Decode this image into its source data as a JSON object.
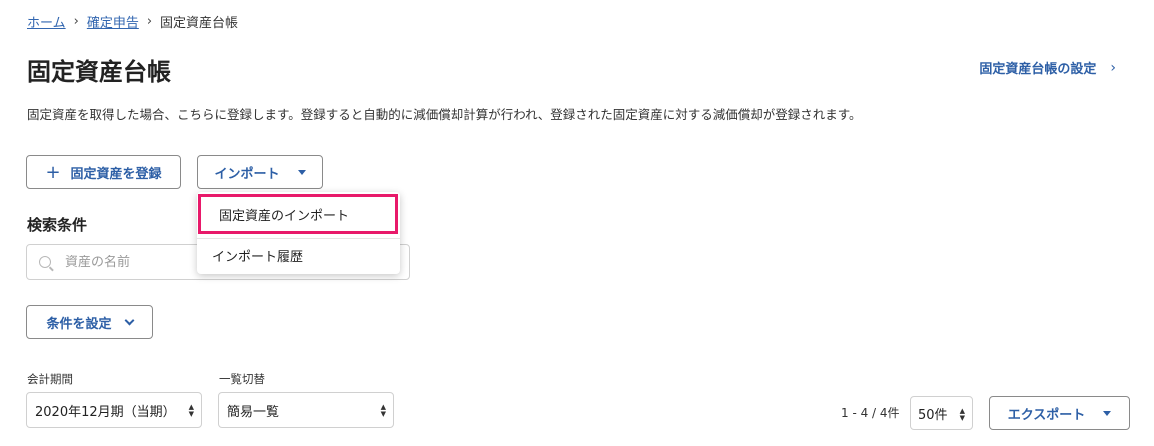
{
  "breadcrumb": {
    "home": "ホーム",
    "tax_return": "確定申告",
    "current": "固定資産台帳",
    "separator": "›"
  },
  "page": {
    "title": "固定資産台帳",
    "settings_link": "固定資産台帳の設定",
    "description": "固定資産を取得した場合、こちらに登録します。登録すると自動的に減価償却計算が行われ、登録された固定資産に対する減価償却が登録されます。"
  },
  "actions": {
    "register_label": "固定資産を登録",
    "import_label": "インポート"
  },
  "import_menu": {
    "items": [
      {
        "label": "固定資産のインポート",
        "highlighted": true
      },
      {
        "label": "インポート履歴",
        "highlighted": false
      }
    ],
    "highlight_color": "#e8196a"
  },
  "search": {
    "section_label": "検索条件",
    "placeholder": "資産の名前",
    "condition_button": "条件を設定"
  },
  "filters": {
    "period_label": "会計期間",
    "period_value": "2020年12月期（当期）",
    "view_label": "一覧切替",
    "view_value": "簡易一覧"
  },
  "pagination": {
    "count_text": "1 - 4 / 4件",
    "per_page": "50件"
  },
  "export": {
    "label": "エクスポート"
  },
  "colors": {
    "link": "#3266b0",
    "button_text": "#2d5fa6"
  },
  "icons": {
    "plus": "plus-icon",
    "caret": "caret-down-icon",
    "search": "search-icon",
    "chevron_right": "chevron-right-icon",
    "chevron_down": "chevron-down-icon"
  }
}
